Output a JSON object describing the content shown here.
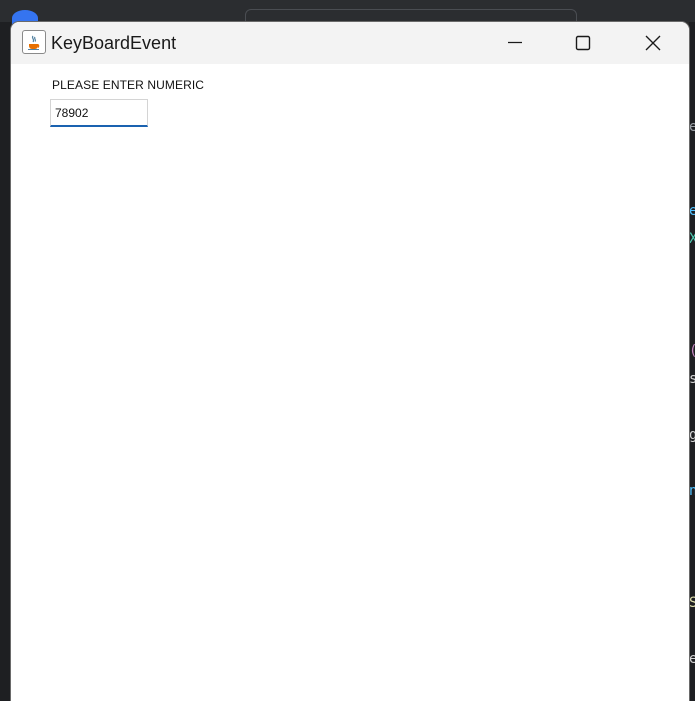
{
  "window": {
    "title": "KeyBoardEvent",
    "icon": "java-icon"
  },
  "controls": {
    "minimize_icon": "minimize-icon",
    "maximize_icon": "maximize-icon",
    "close_icon": "close-icon"
  },
  "form": {
    "prompt_label": "PLEASE ENTER NUMERIC",
    "numeric_value": "78902"
  },
  "colors": {
    "input_focus_underline": "#1a62b0",
    "titlebar_bg": "#f3f3f3"
  }
}
